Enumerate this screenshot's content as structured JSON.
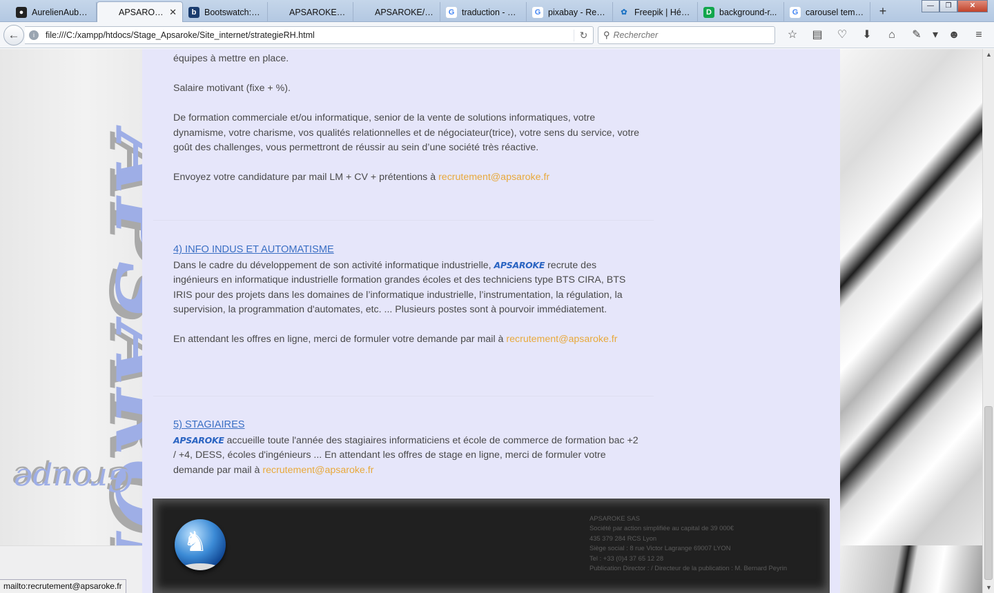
{
  "browser": {
    "tabs": [
      {
        "label": "AurelienAube...",
        "favicon": "github-icon",
        "glyph": "●",
        "active": false
      },
      {
        "label": "APSAROKE/Re...",
        "favicon": "page-icon",
        "glyph": "",
        "active": true
      },
      {
        "label": "Bootswatch: F...",
        "favicon": "bootswatch-icon",
        "glyph": "b",
        "active": false
      },
      {
        "label": "APSAROKE/société",
        "favicon": "page-icon",
        "glyph": "",
        "active": false
      },
      {
        "label": "APSAROKE/Métier...",
        "favicon": "page-icon",
        "glyph": "",
        "active": false
      },
      {
        "label": "traduction - R...",
        "favicon": "google-icon",
        "glyph": "G",
        "active": false
      },
      {
        "label": "pixabay - Rec...",
        "favicon": "google-icon",
        "glyph": "G",
        "active": false
      },
      {
        "label": "Freepik | Hébe...",
        "favicon": "freepik-icon",
        "glyph": "✿",
        "active": false
      },
      {
        "label": "background-r...",
        "favicon": "d-icon",
        "glyph": "D",
        "active": false
      },
      {
        "label": "carousel temp...",
        "favicon": "google-icon",
        "glyph": "G",
        "active": false
      }
    ],
    "tab_close_glyph": "✕",
    "new_tab_glyph": "+",
    "window_controls": {
      "minimize": "—",
      "maximize": "❐",
      "close": "✕"
    },
    "back_glyph": "←",
    "url": "file:///C:/xampp/htdocs/Stage_Apsaroke/Site_internet/strategieRH.html",
    "reload_glyph": "↻",
    "search_placeholder": "Rechercher",
    "search_glyph": "⚲",
    "toolbar_icons": [
      {
        "name": "bookmark-star-icon",
        "glyph": "☆"
      },
      {
        "name": "reading-list-icon",
        "glyph": "▤"
      },
      {
        "name": "pocket-icon",
        "glyph": "♡"
      },
      {
        "name": "download-icon",
        "glyph": "⬇"
      },
      {
        "name": "home-icon",
        "glyph": "⌂"
      },
      {
        "name": "extension-icon",
        "glyph": "✎"
      },
      {
        "name": "dropdown-icon",
        "glyph": "▾"
      },
      {
        "name": "chat-icon",
        "glyph": "☻"
      },
      {
        "name": "menu-icon",
        "glyph": "≡"
      }
    ],
    "status_text": "mailto:recrutement@apsaroke.fr"
  },
  "page": {
    "side_logo_text": "APSAROKE",
    "side_logo_sub": "Groupe",
    "section3": {
      "line_top": "équipes à mettre en place.",
      "salary": "Salaire motivant (fixe + %).",
      "profile": "De formation commerciale et/ou informatique, senior de la vente de solutions informatiques, votre dynamisme, votre charisme, vos qualités relationnelles et de négociateur(trice), votre sens du service, votre goût des challenges, vous permettront de réussir au sein d’une société très réactive.",
      "apply_text": "Envoyez votre candidature par mail LM + CV + prétentions à",
      "email": "recrutement@apsaroke.fr"
    },
    "section4": {
      "title": "4) INFO INDUS ET AUTOMATISME",
      "text_before_brand": "Dans le cadre du développement de son activité informatique industrielle,",
      "brand": "APSAROKE",
      "text_after_brand": "recrute des ingénieurs en informatique industrielle formation grandes écoles et des techniciens type BTS CIRA, BTS IRIS pour des projets dans les domaines de l’informatique industrielle, l’instrumentation, la régulation, la supervision, la programmation d'automates, etc. ... Plusieurs postes sont à pourvoir immédiatement.",
      "offers_text": "En attendant les offres en ligne, merci de formuler votre demande par mail à",
      "email": "recrutement@apsaroke.fr"
    },
    "section5": {
      "title": "5) STAGIAIRES",
      "brand": "APSAROKE",
      "text": "accueille toute l'année des stagiaires informaticiens et école de commerce de formation bac +2 / +4, DESS, écoles d'ingénieurs ... En attendant les offres de stage en ligne, merci de formuler votre demande par mail à",
      "email": "recrutement@apsaroke.fr"
    },
    "footer": {
      "lines": [
        "APSAROKE SAS",
        "Société par action simplifiée au capital de 39 000€",
        "435 379 284 RCS Lyon",
        "Siège social : 8 rue Victor Lagrange 69007 LYON",
        "Tel : +33 (0)4 37 65 12 28",
        "Publication Director : / Directeur de la publication : M. Bernard Peyrin"
      ]
    }
  },
  "colors": {
    "content_bg": "#e6e6fa",
    "link_blue": "#3a6fc4",
    "mail_orange": "#e8a93c",
    "footer_bg": "#202020"
  }
}
